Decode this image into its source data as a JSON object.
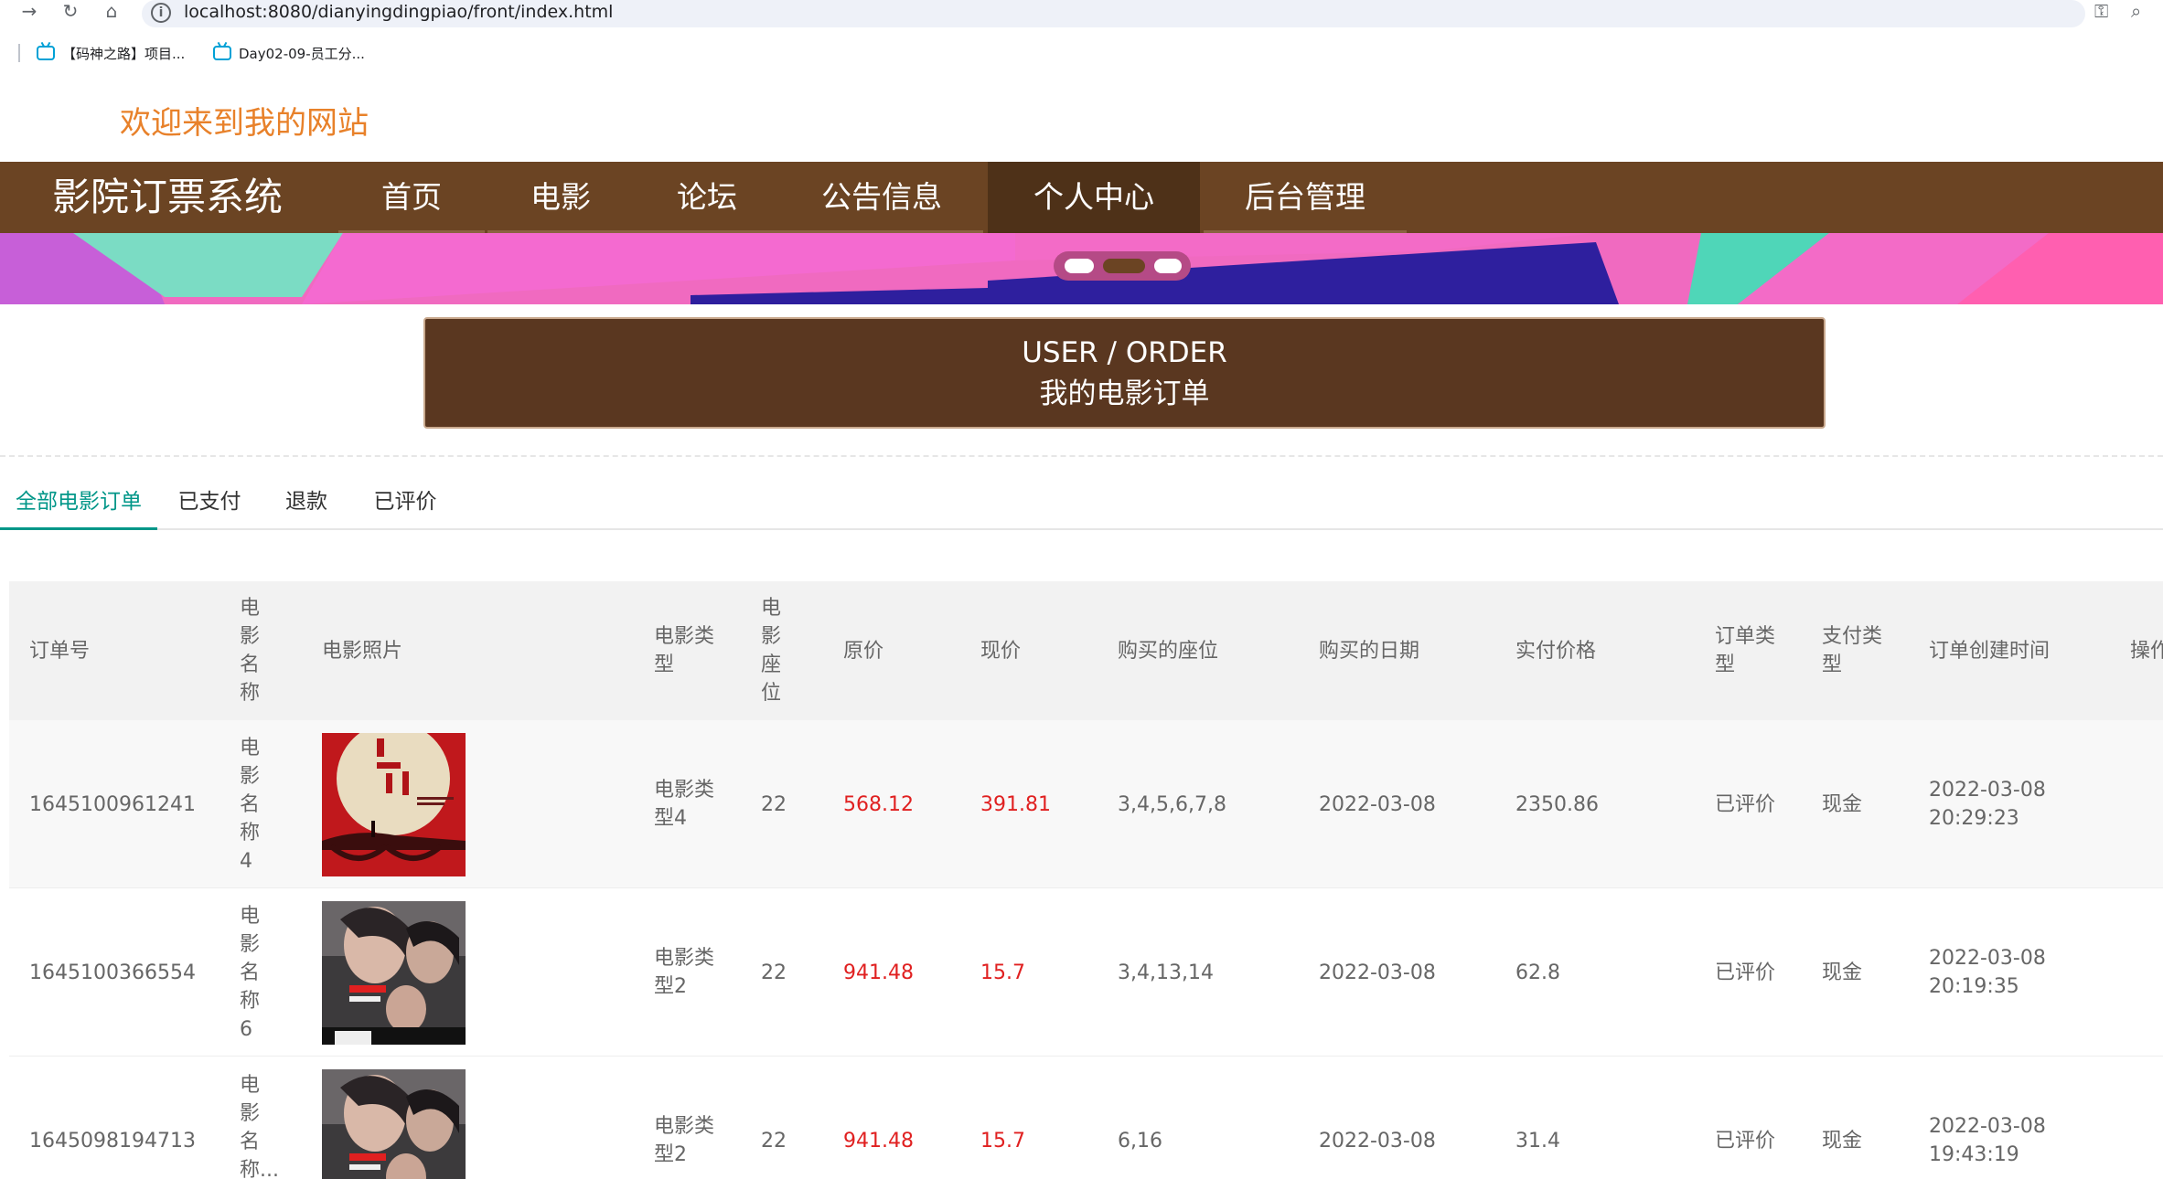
{
  "browser": {
    "url": "localhost:8080/dianyingdingpiao/front/index.html",
    "bookmarks": [
      {
        "label": "【码神之路】项目..."
      },
      {
        "label": "Day02-09-员工分..."
      }
    ]
  },
  "header": {
    "welcome": "欢迎来到我的网站",
    "site_title": "影院订票系统",
    "nav": [
      {
        "label": "首页"
      },
      {
        "label": "电影"
      },
      {
        "label": "论坛"
      },
      {
        "label": "公告信息"
      },
      {
        "label": "个人中心"
      },
      {
        "label": "后台管理"
      }
    ],
    "active_nav": "个人中心"
  },
  "section": {
    "title_en": "USER / ORDER",
    "title_cn": "我的电影订单"
  },
  "tabs": [
    {
      "label": "全部电影订单"
    },
    {
      "label": "已支付"
    },
    {
      "label": "退款"
    },
    {
      "label": "已评价"
    }
  ],
  "active_tab": "全部电影订单",
  "table": {
    "columns": [
      "订单号",
      "电影名称",
      "电影照片",
      "电影类型",
      "电影座位",
      "原价",
      "现价",
      "购买的座位",
      "购买的日期",
      "实付价格",
      "订单类型",
      "支付类型",
      "订单创建时间",
      "操作"
    ],
    "rows": [
      {
        "order_no": "1645100961241",
        "movie_name": "电影名称4",
        "poster": "poster-red-moon",
        "movie_type": "电影类型4",
        "seat_count": "22",
        "orig_price": "568.12",
        "cur_price": "391.81",
        "seats": "3,4,5,6,7,8",
        "date": "2022-03-08",
        "paid": "2350.86",
        "order_type": "已评价",
        "pay_type": "现金",
        "created": "2022-03-08 20:29:23"
      },
      {
        "order_no": "1645100366554",
        "movie_name": "电影名称6",
        "poster": "poster-portrait",
        "movie_type": "电影类型2",
        "seat_count": "22",
        "orig_price": "941.48",
        "cur_price": "15.7",
        "seats": "3,4,13,14",
        "date": "2022-03-08",
        "paid": "62.8",
        "order_type": "已评价",
        "pay_type": "现金",
        "created": "2022-03-08 20:19:35"
      },
      {
        "order_no": "1645098194713",
        "movie_name": "电影名称...",
        "poster": "poster-portrait",
        "movie_type": "电影类型2",
        "seat_count": "22",
        "orig_price": "941.48",
        "cur_price": "15.7",
        "seats": "6,16",
        "date": "2022-03-08",
        "paid": "31.4",
        "order_type": "已评价",
        "pay_type": "现金",
        "created": "2022-03-08 19:43:19"
      }
    ]
  },
  "colors": {
    "nav_bg": "#6b4423",
    "nav_active": "#4e3118",
    "title_box": "#5a3720",
    "welcome": "#e8812a",
    "tab_active": "#009688",
    "price_red": "#e02020"
  }
}
